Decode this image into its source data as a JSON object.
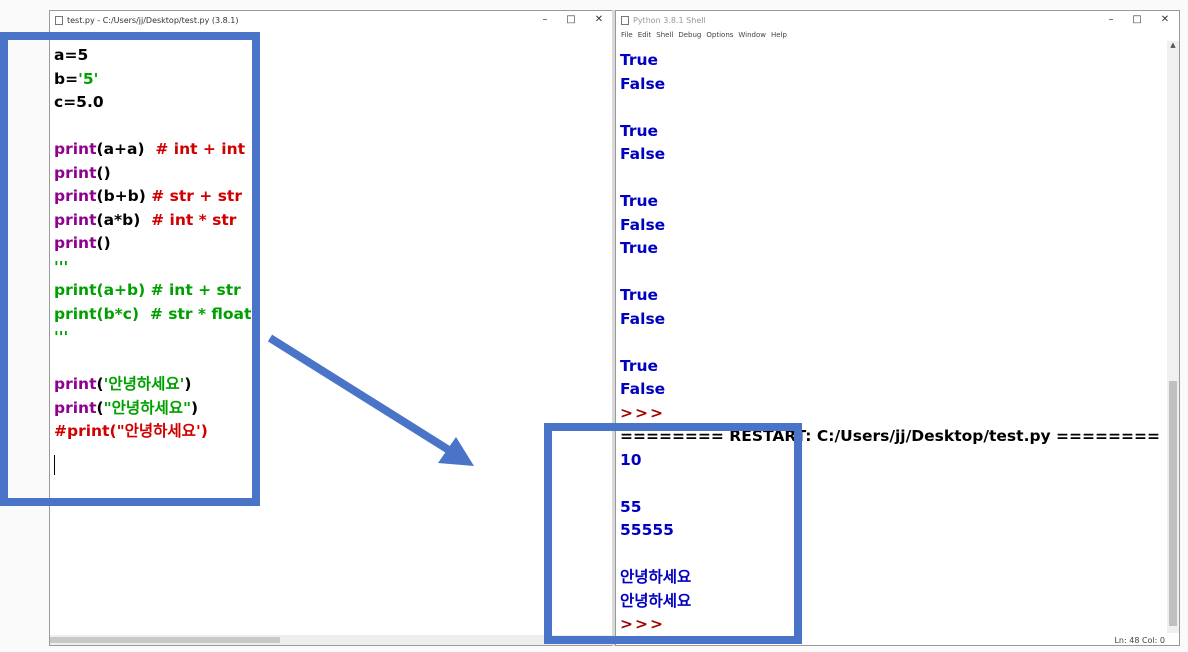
{
  "editor": {
    "title": "test.py - C:/Users/jj/Desktop/test.py (3.8.1)",
    "lines": [
      [
        {
          "t": "a=5",
          "c": "df"
        }
      ],
      [
        {
          "t": "b=",
          "c": "df"
        },
        {
          "t": "'5'",
          "c": "str"
        }
      ],
      [
        {
          "t": "c=5.0",
          "c": "df"
        }
      ],
      [],
      [
        {
          "t": "print",
          "c": "kw"
        },
        {
          "t": "(a+a)  ",
          "c": "df"
        },
        {
          "t": "# int + int",
          "c": "cm"
        }
      ],
      [
        {
          "t": "print",
          "c": "kw"
        },
        {
          "t": "()",
          "c": "df"
        }
      ],
      [
        {
          "t": "print",
          "c": "kw"
        },
        {
          "t": "(b+b) ",
          "c": "df"
        },
        {
          "t": "# str + str",
          "c": "cm"
        }
      ],
      [
        {
          "t": "print",
          "c": "kw"
        },
        {
          "t": "(a*b)  ",
          "c": "df"
        },
        {
          "t": "# int * str",
          "c": "cm"
        }
      ],
      [
        {
          "t": "print",
          "c": "kw"
        },
        {
          "t": "()",
          "c": "df"
        }
      ],
      [
        {
          "t": "'''",
          "c": "str"
        }
      ],
      [
        {
          "t": "print(a+b) # int + str",
          "c": "str"
        }
      ],
      [
        {
          "t": "print(b*c)  # str * float",
          "c": "str"
        }
      ],
      [
        {
          "t": "'''",
          "c": "str"
        }
      ],
      [],
      [
        {
          "t": "print",
          "c": "kw"
        },
        {
          "t": "(",
          "c": "df"
        },
        {
          "t": "'안녕하세요'",
          "c": "str"
        },
        {
          "t": ")",
          "c": "df"
        }
      ],
      [
        {
          "t": "print",
          "c": "kw"
        },
        {
          "t": "(",
          "c": "df"
        },
        {
          "t": "\"안녕하세요\"",
          "c": "str"
        },
        {
          "t": ")",
          "c": "df"
        }
      ],
      [
        {
          "t": "#print(\"안녕하세요')",
          "c": "cm"
        }
      ]
    ]
  },
  "shell": {
    "title": "Python 3.8.1 Shell",
    "menu": [
      "File",
      "Edit",
      "Shell",
      "Debug",
      "Options",
      "Window",
      "Help"
    ],
    "lines": [
      {
        "t": "True",
        "c": "o"
      },
      {
        "t": "False",
        "c": "o"
      },
      {
        "t": "",
        "c": "o"
      },
      {
        "t": "True",
        "c": "o"
      },
      {
        "t": "False",
        "c": "o"
      },
      {
        "t": "",
        "c": "o"
      },
      {
        "t": "True",
        "c": "o"
      },
      {
        "t": "False",
        "c": "o"
      },
      {
        "t": "True",
        "c": "o"
      },
      {
        "t": "",
        "c": "o"
      },
      {
        "t": "True",
        "c": "o"
      },
      {
        "t": "False",
        "c": "o"
      },
      {
        "t": "",
        "c": "o"
      },
      {
        "t": "True",
        "c": "o"
      },
      {
        "t": "False",
        "c": "o"
      },
      {
        "t": ">>>",
        "c": "p"
      },
      {
        "t": "======== RESTART: C:/Users/jj/Desktop/test.py ========",
        "c": "r"
      },
      {
        "t": "10",
        "c": "o"
      },
      {
        "t": "",
        "c": "o"
      },
      {
        "t": "55",
        "c": "o"
      },
      {
        "t": "55555",
        "c": "o"
      },
      {
        "t": "",
        "c": "o"
      },
      {
        "t": "안녕하세요",
        "c": "o"
      },
      {
        "t": "안녕하세요",
        "c": "o"
      },
      {
        "t": ">>>",
        "c": "p"
      }
    ],
    "status": "Ln: 48  Col: 0"
  },
  "window_buttons": {
    "minimize": "–",
    "maximize": "□",
    "close": "✕"
  },
  "colors": {
    "annotation": "#4a74c8",
    "keyword": "#900090",
    "string": "#00a000",
    "comment": "#d00000",
    "output": "#0000c0",
    "prompt": "#a00000"
  }
}
